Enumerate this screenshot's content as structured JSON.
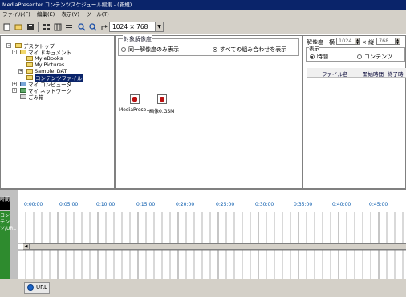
{
  "window": {
    "title": "MediaPresenter コンテンツスケジュール編集 - (新規)"
  },
  "menu": {
    "items": [
      "ファイル(F)",
      "編集(E)",
      "表示(V)",
      "ツール(T)"
    ]
  },
  "toolbar": {
    "resolution_value": "1024 × 768",
    "icons": [
      "new-icon",
      "open-icon",
      "save-icon",
      "tile-icon",
      "grid-icon",
      "list-icon",
      "zoom-in-icon",
      "zoom-out-icon",
      "export-icon"
    ]
  },
  "tree": {
    "items": [
      "デスクトップ",
      "マイ ドキュメント",
      "My eBooks",
      "My Pictures",
      "Sample_DAT",
      "コンテンツファイル",
      "マイ コンピュータ",
      "マイ ネットワーク",
      "ごみ箱"
    ]
  },
  "resolution_target": {
    "title": "対象解像度",
    "option_same": "同一解像度のみ表示",
    "option_all": "すべての組み合わせを表示"
  },
  "files": [
    {
      "label": "MediaPrese…",
      "icon": "media-presenter-icon"
    },
    {
      "label": "画像0.GSM",
      "icon": "image-file-icon"
    }
  ],
  "right_panel": {
    "resolution_label": "解像度",
    "width_label": "横",
    "width_value": "1024",
    "times_label": "× 縦",
    "height_value": "768",
    "display_label": "表示",
    "radio_time": "時間",
    "radio_content": "コンテンツ",
    "columns": [
      "ファイル名",
      "開始時間",
      "終了時"
    ]
  },
  "timeline": {
    "time_label": "時間",
    "content_label": "コンテンツ/URL",
    "ticks": [
      "0:00:00",
      "0:05:00",
      "0:10:00",
      "0:15:00",
      "0:20:00",
      "0:25:00",
      "0:30:00",
      "0:35:00",
      "0:40:00",
      "0:45:00"
    ]
  },
  "bottom": {
    "url_button": "URL"
  }
}
